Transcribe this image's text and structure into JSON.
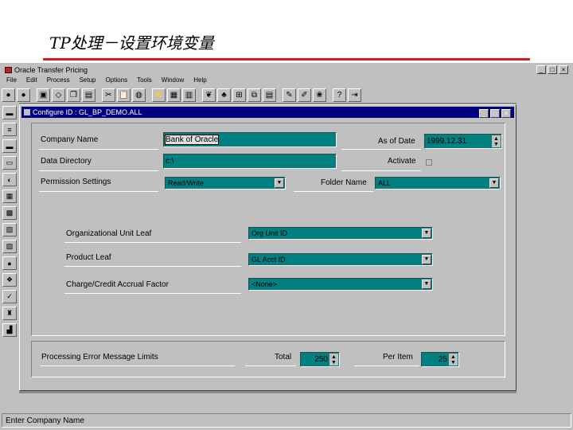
{
  "slide": {
    "title": "TP处理－设置环境变量"
  },
  "app": {
    "title": "Oracle Transfer Pricing",
    "window_buttons": [
      "_",
      "□",
      "×"
    ],
    "menu": [
      "File",
      "Edit",
      "Process",
      "Setup",
      "Options",
      "Tools",
      "Window",
      "Help"
    ]
  },
  "child": {
    "title": "Configure ID : GL_BP_DEMO.ALL",
    "window_buttons": [
      "_",
      "□",
      "×"
    ]
  },
  "form": {
    "company_name_label": "Company Name",
    "company_name_value": "Bank of Oracle",
    "as_of_date_label": "As of Date",
    "as_of_date_value": "1999.12.31",
    "data_directory_label": "Data Directory",
    "data_directory_value": "c:\\",
    "activate_label": "Activate",
    "permission_label": "Permission Settings",
    "permission_value": "Read/Write",
    "folder_name_label": "Folder Name",
    "folder_name_value": "ALL",
    "org_unit_leaf_label": "Organizational Unit Leaf",
    "org_unit_leaf_value": "Org Unit ID",
    "product_leaf_label": "Product Leaf",
    "product_leaf_value": "GL Acct ID",
    "charge_credit_label": "Charge/Credit Accrual Factor",
    "charge_credit_value": "<None>",
    "processing_error_label": "Processing Error Message Limits",
    "total_label": "Total",
    "total_value": "250",
    "per_item_label": "Per Item",
    "per_item_value": "25"
  },
  "status": {
    "text": "Enter Company Name"
  }
}
